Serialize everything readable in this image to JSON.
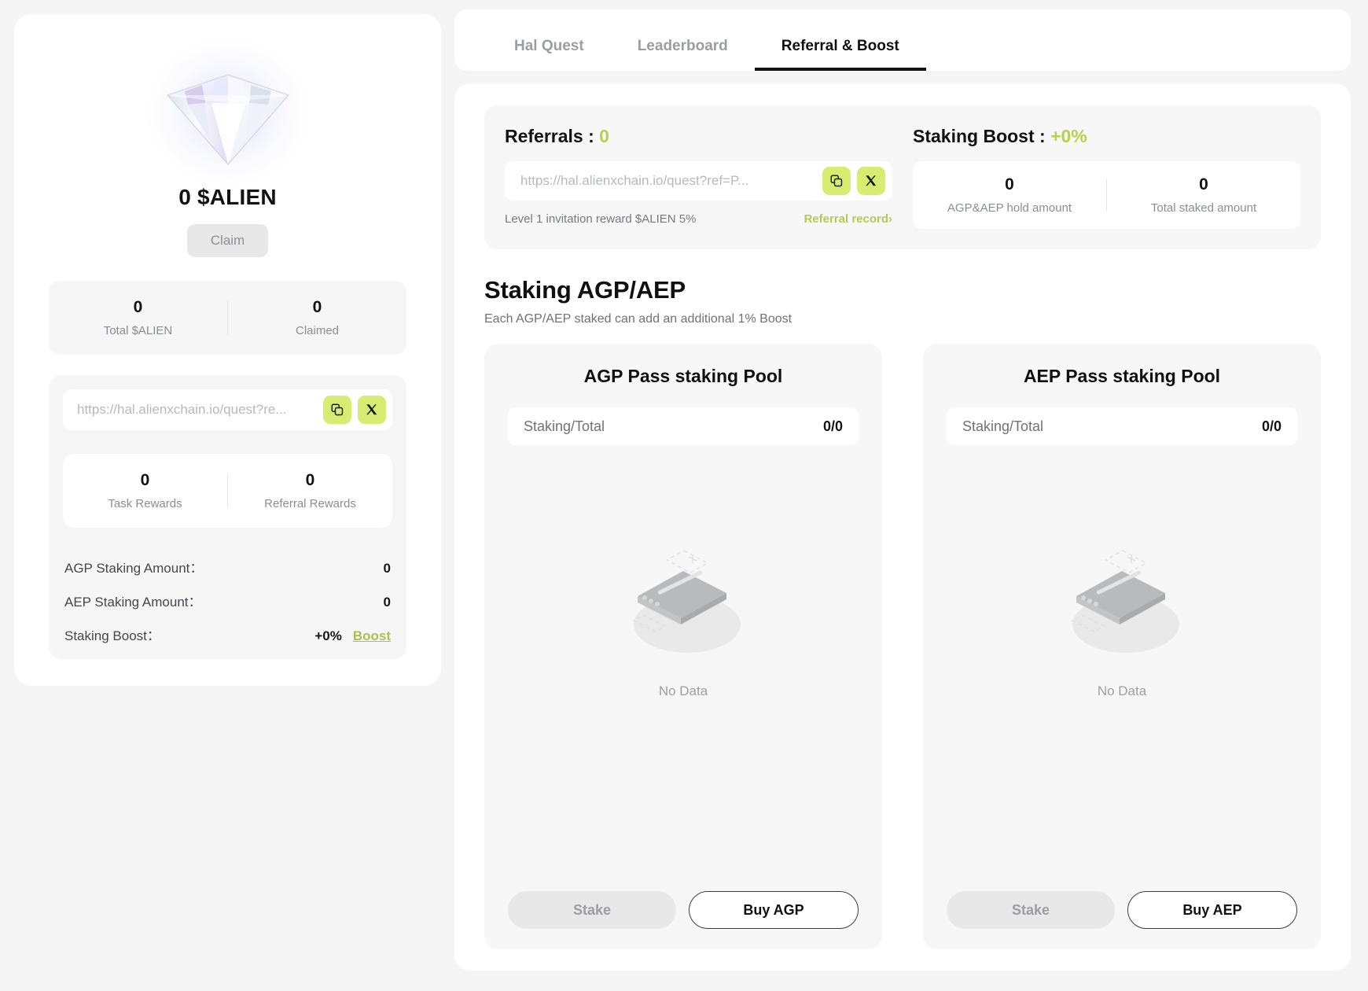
{
  "left": {
    "gem_icon": "diamond-gem",
    "balance": "0 $ALIEN",
    "claim_label": "Claim",
    "stats": [
      {
        "value": "0",
        "label": "Total $ALIEN"
      },
      {
        "value": "0",
        "label": "Claimed"
      }
    ],
    "referral_link": "https://hal.alienxchain.io/quest?re...",
    "copy_icon": "copy-icon",
    "x_icon": "x-twitter-icon",
    "rewards": [
      {
        "value": "0",
        "label": "Task Rewards"
      },
      {
        "value": "0",
        "label": "Referral Rewards"
      }
    ],
    "amounts": [
      {
        "label": "AGP Staking Amount：",
        "value": "0"
      },
      {
        "label": "AEP Staking Amount：",
        "value": "0"
      }
    ],
    "boost_row": {
      "label": "Staking Boost：",
      "value": "+0%",
      "link": "Boost"
    }
  },
  "tabs": [
    {
      "label": "Hal Quest",
      "active": false
    },
    {
      "label": "Leaderboard",
      "active": false
    },
    {
      "label": "Referral & Boost",
      "active": true
    }
  ],
  "referrals": {
    "title": "Referrals :",
    "count": "0",
    "link": "https://hal.alienxchain.io/quest?ref=P...",
    "copy_icon": "copy-icon",
    "x_icon": "x-twitter-icon",
    "note": "Level 1 invitation reward $ALIEN 5%",
    "record_link": "Referral record›"
  },
  "staking_boost": {
    "title": "Staking Boost :",
    "value": "+0%",
    "stats": [
      {
        "value": "0",
        "label": "AGP&AEP hold amount"
      },
      {
        "value": "0",
        "label": "Total staked amount"
      }
    ]
  },
  "staking_section": {
    "title": "Staking AGP/AEP",
    "subtitle": "Each AGP/AEP staked can add an additional 1% Boost"
  },
  "pools": [
    {
      "title": "AGP Pass staking Pool",
      "strip_label": "Staking/Total",
      "strip_value": "0/0",
      "empty_icon": "empty-box-icon",
      "empty_label": "No Data",
      "stake_label": "Stake",
      "buy_label": "Buy AGP"
    },
    {
      "title": "AEP Pass staking Pool",
      "strip_label": "Staking/Total",
      "strip_value": "0/0",
      "empty_icon": "empty-box-icon",
      "empty_label": "No Data",
      "stake_label": "Stake",
      "buy_label": "Buy AEP"
    }
  ],
  "colors": {
    "accent_green": "#b5d24a",
    "button_green": "#d6ed72",
    "page_bg": "#f5f5f6",
    "text_dark": "#111214"
  }
}
